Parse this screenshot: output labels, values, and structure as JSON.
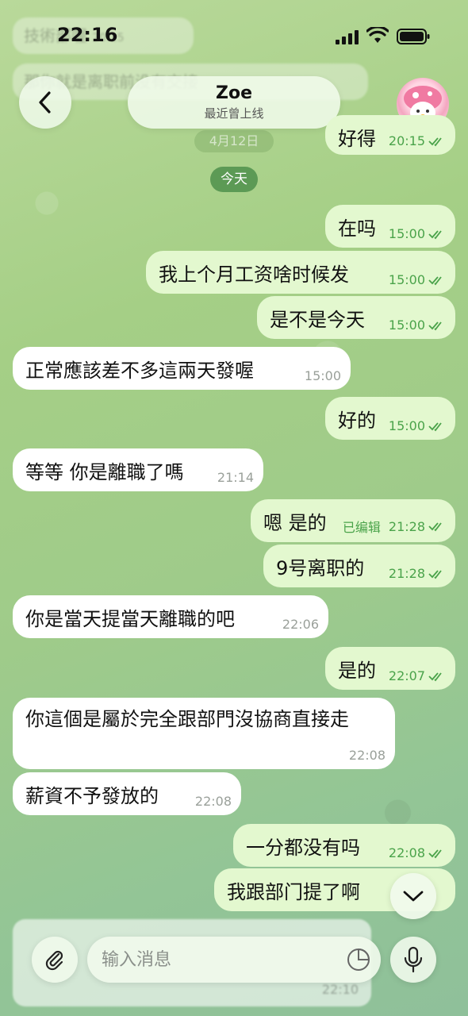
{
  "status_bar": {
    "time": "22:16"
  },
  "header": {
    "name": "Zoe",
    "status": "最近曾上线"
  },
  "faded_top": {
    "line1": "技術部喔",
    "line1_time": "20:15",
    "line2": "那你就是离职前没有交接",
    "date": "4月12日"
  },
  "date_chip": "今天",
  "messages": [
    {
      "text": "好得",
      "time": "20:15",
      "dir": "out"
    },
    {
      "text": "在吗",
      "time": "15:00",
      "dir": "out"
    },
    {
      "text": "我上个月工资啥时候发",
      "time": "15:00",
      "dir": "out"
    },
    {
      "text": "是不是今天",
      "time": "15:00",
      "dir": "out"
    },
    {
      "text": "正常應該差不多這兩天發喔",
      "time": "15:00",
      "dir": "in"
    },
    {
      "text": "好的",
      "time": "15:00",
      "dir": "out"
    },
    {
      "text": "等等 你是離職了嗎",
      "time": "21:14",
      "dir": "in"
    },
    {
      "text": "嗯 是的",
      "time": "21:28",
      "edited": "已编辑",
      "dir": "out"
    },
    {
      "text": "9号离职的",
      "time": "21:28",
      "dir": "out"
    },
    {
      "text": "你是當天提當天離職的吧",
      "time": "22:06",
      "dir": "in"
    },
    {
      "text": "是的",
      "time": "22:07",
      "dir": "out"
    },
    {
      "text": "你這個是屬於完全跟部門沒協商直接走",
      "time": "22:08",
      "dir": "in"
    },
    {
      "text": "薪資不予發放的",
      "time": "22:08",
      "dir": "in"
    },
    {
      "text": "一分都没有吗",
      "time": "22:08",
      "dir": "out"
    },
    {
      "text": "我跟部门提了啊",
      "time": "",
      "dir": "out"
    }
  ],
  "input": {
    "placeholder": "输入消息"
  },
  "ghost_time": "22:10"
}
